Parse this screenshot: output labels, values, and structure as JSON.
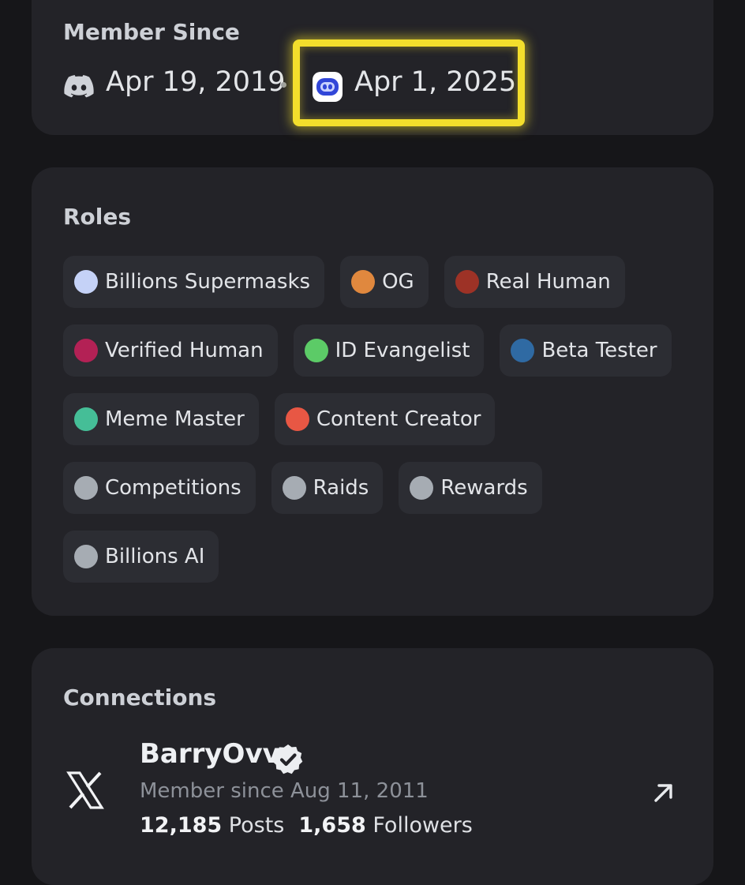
{
  "member_since": {
    "title": "Member Since",
    "discord_icon": "discord-icon",
    "discord_date": "Apr 19, 2019",
    "server_icon": "server-robot-icon",
    "server_date": "Apr 1, 2025",
    "highlight_color": "#f3de2c"
  },
  "roles": {
    "title": "Roles",
    "items": [
      {
        "label": "Billions Supermasks",
        "color": "#c5d2f7"
      },
      {
        "label": "OG",
        "color": "#e0883e"
      },
      {
        "label": "Real Human",
        "color": "#9d3226"
      },
      {
        "label": "Verified Human",
        "color": "#b32155"
      },
      {
        "label": "ID Evangelist",
        "color": "#5ccb67"
      },
      {
        "label": "Beta Tester",
        "color": "#2f6aa3"
      },
      {
        "label": "Meme Master",
        "color": "#45be97"
      },
      {
        "label": "Content Creator",
        "color": "#e85744"
      },
      {
        "label": "Competitions",
        "color": "#a6acb3"
      },
      {
        "label": "Raids",
        "color": "#a6acb3"
      },
      {
        "label": "Rewards",
        "color": "#a6acb3"
      },
      {
        "label": "Billions AI",
        "color": "#a6acb3"
      }
    ]
  },
  "connections": {
    "title": "Connections",
    "items": [
      {
        "platform_icon": "x-logo-icon",
        "name": "BarryOvv",
        "verified_icon": "verified-badge-icon",
        "member_since": "Member since Aug 11, 2011",
        "posts_count": "12,185",
        "posts_label": "Posts",
        "followers_count": "1,658",
        "followers_label": "Followers",
        "link_icon": "arrow-up-right-icon"
      }
    ]
  }
}
